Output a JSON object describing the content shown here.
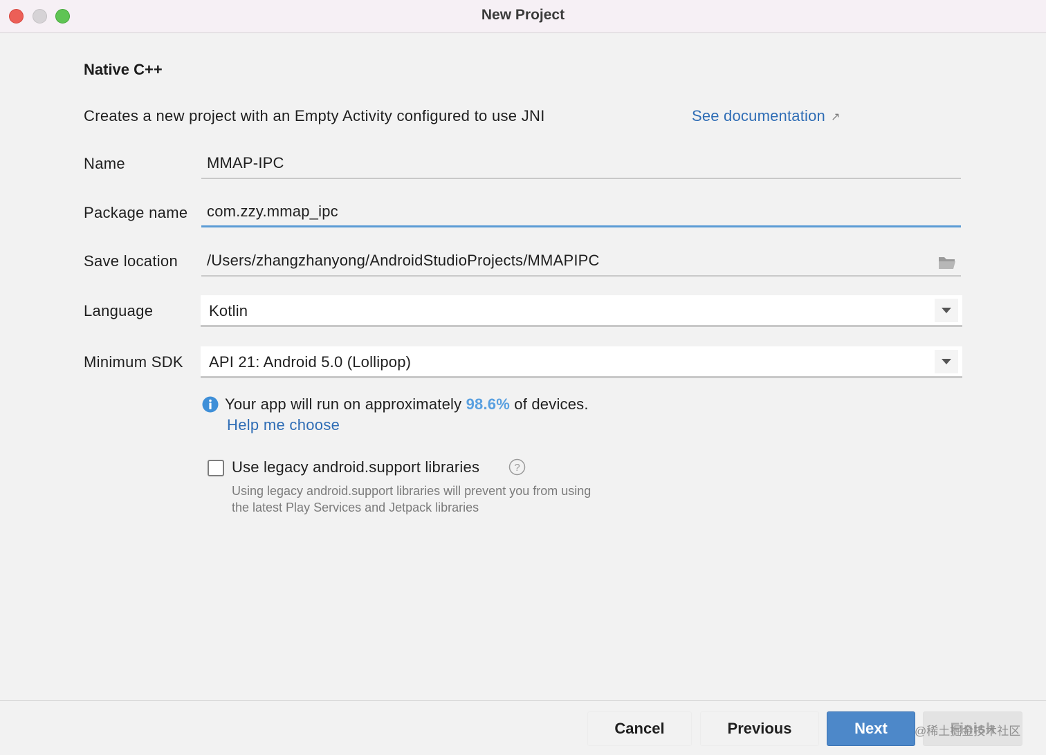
{
  "window": {
    "title": "New Project"
  },
  "template": {
    "heading": "Native C++",
    "description": "Creates a new project with an Empty Activity configured to use JNI",
    "doc_link": "See documentation"
  },
  "form": {
    "name": {
      "label": "Name",
      "value": "MMAP-IPC"
    },
    "package": {
      "label": "Package name",
      "value": "com.zzy.mmap_ipc"
    },
    "save_location": {
      "label": "Save location",
      "value": "/Users/zhangzhanyong/AndroidStudioProjects/MMAPIPC"
    },
    "language": {
      "label": "Language",
      "value": "Kotlin"
    },
    "min_sdk": {
      "label": "Minimum SDK",
      "value": "API 21: Android 5.0 (Lollipop)"
    }
  },
  "info": {
    "prefix": "Your app will run on approximately ",
    "percent": "98.6%",
    "suffix": " of devices.",
    "help_link": "Help me choose"
  },
  "legacy": {
    "checkbox_label": "Use legacy android.support libraries",
    "checked": false,
    "note_line1": "Using legacy android.support libraries will prevent you from using",
    "note_line2": "the latest Play Services and Jetpack libraries"
  },
  "buttons": {
    "cancel": "Cancel",
    "previous": "Previous",
    "next": "Next",
    "finish": "Finish"
  },
  "watermark": "@稀土掘金技术社区",
  "colors": {
    "accent": "#4d88c9",
    "link": "#2f6db5",
    "focus": "#5b9bd5",
    "info": "#5aa0e0"
  }
}
